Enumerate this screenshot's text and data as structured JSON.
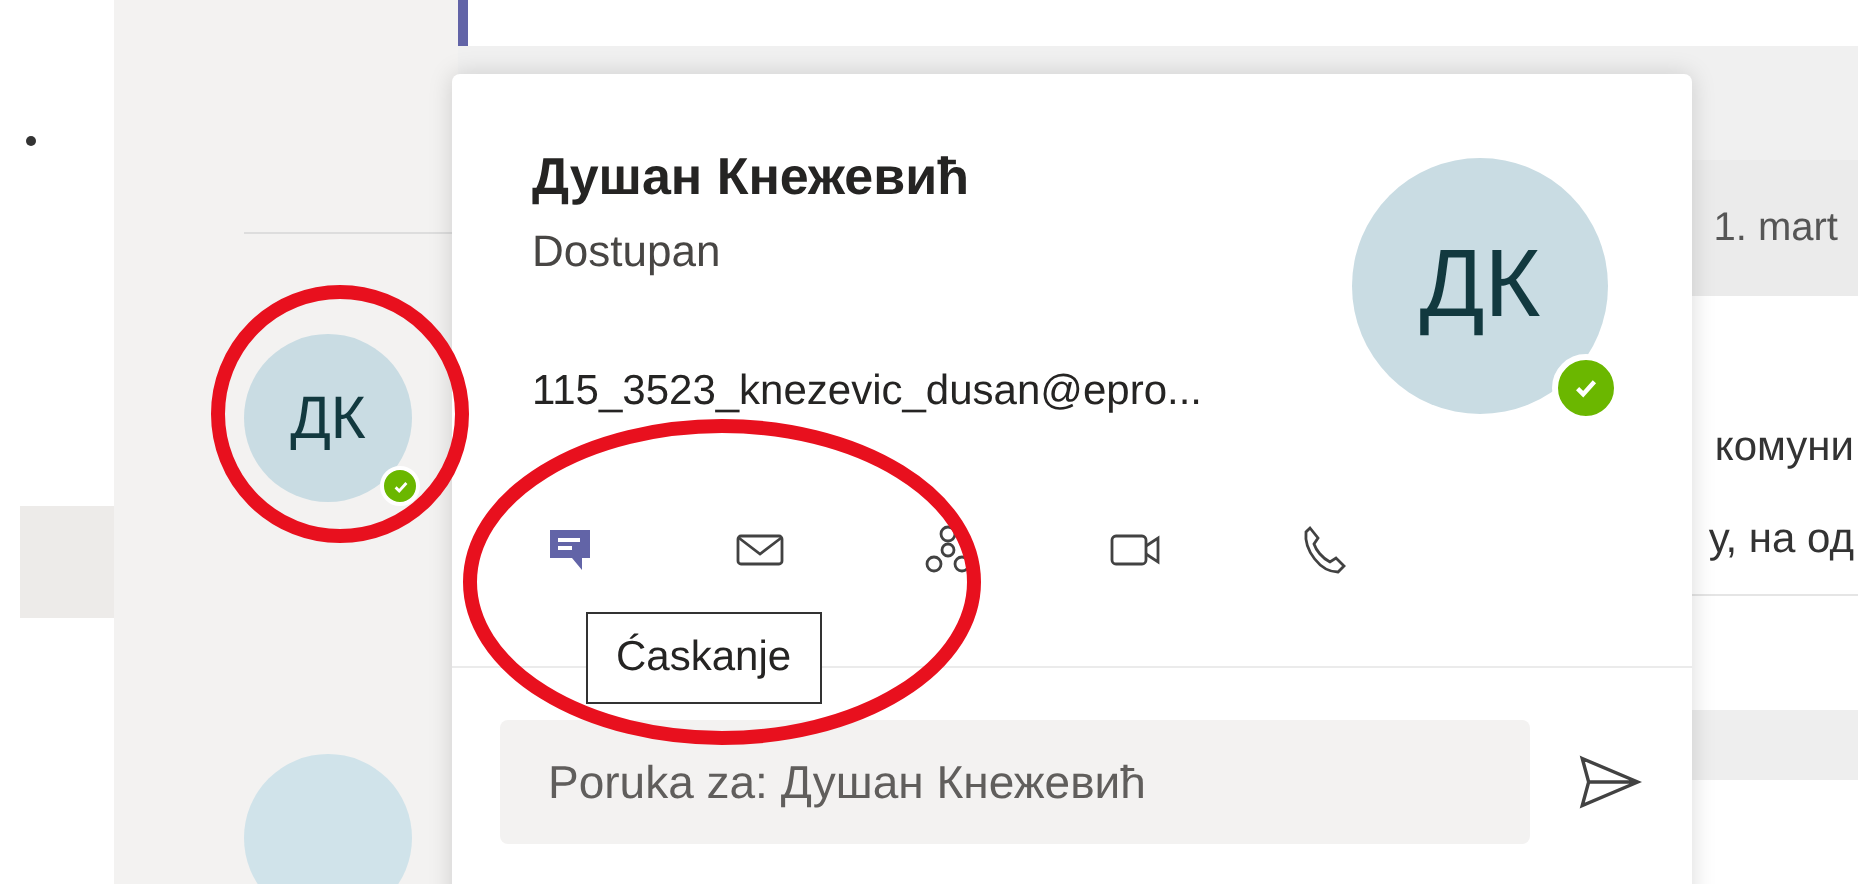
{
  "list": {
    "avatars": [
      {
        "initials": "ДК",
        "available": true
      }
    ]
  },
  "background": {
    "date": "1. mart",
    "lines": [
      "комуни",
      "у, на од"
    ]
  },
  "card": {
    "name": "Душан Кнежевић",
    "status": "Dostupan",
    "email": "115_3523_knezevic_dusan@epro...",
    "initials": "ДК",
    "available": true,
    "actions": [
      {
        "kind": "chat",
        "selected": true
      },
      {
        "kind": "mail",
        "selected": false
      },
      {
        "kind": "org",
        "selected": false
      },
      {
        "kind": "video",
        "selected": false
      },
      {
        "kind": "call",
        "selected": false
      }
    ],
    "tooltip": "Ćaskanje",
    "message": {
      "placeholder": "Poruka za: Душан Кнежевић"
    }
  }
}
